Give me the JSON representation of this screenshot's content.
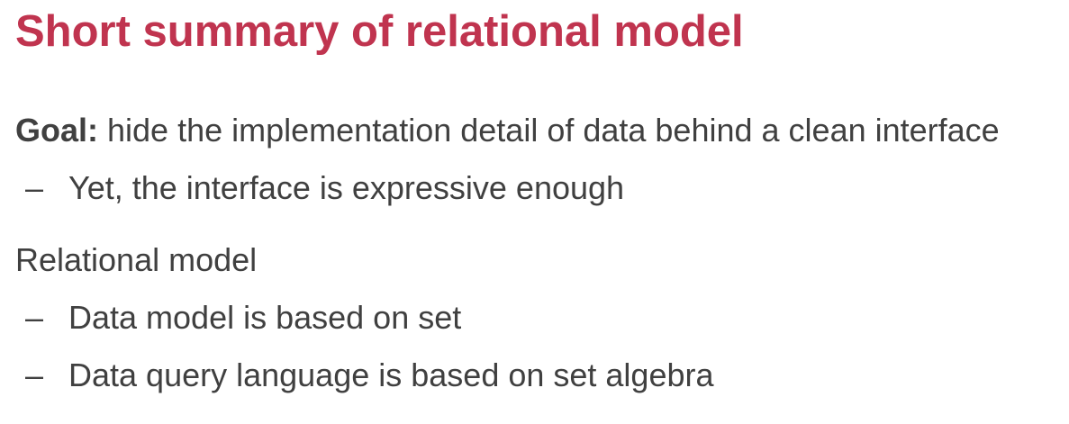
{
  "slide": {
    "title": "Short summary of relational model",
    "goal": {
      "label": "Goal:",
      "text": " hide the implementation detail of data behind a clean interface",
      "bullets": [
        {
          "marker": "–",
          "text": "Yet, the interface is expressive enough"
        }
      ]
    },
    "relational": {
      "text": "Relational model",
      "bullets": [
        {
          "marker": "–",
          "text": "Data model is based on set"
        },
        {
          "marker": "–",
          "text": "Data query language is based on set algebra"
        }
      ]
    },
    "colors": {
      "title": "#c0344f",
      "body": "#404040"
    }
  }
}
